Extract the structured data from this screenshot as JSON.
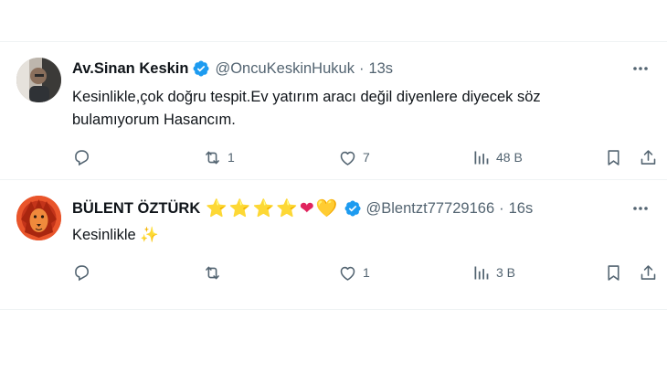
{
  "tweets": [
    {
      "author": "Av.Sinan Keskin",
      "handle": "@OncuKeskinHukuk",
      "separator": "·",
      "time": "13s",
      "text": "Kesinlikle,çok doğru tespit.Ev yatırım aracı değil diyenlere diyecek söz bulamıyorum Hasancım.",
      "replies": "",
      "reposts": "1",
      "likes": "7",
      "views": "48 B"
    },
    {
      "author": "BÜLENT ÖZTÜRK",
      "name_emojis": [
        "⭐",
        "⭐",
        "⭐",
        "⭐",
        "❤",
        "💛"
      ],
      "handle": "@Blentzt77729166",
      "separator": "·",
      "time": "16s",
      "text": "Kesinlikle ✨",
      "replies": "",
      "reposts": "",
      "likes": "1",
      "views": "3 B"
    }
  ],
  "icons": {
    "verified_color": "#1d9bf0",
    "action_color": "#536471"
  }
}
